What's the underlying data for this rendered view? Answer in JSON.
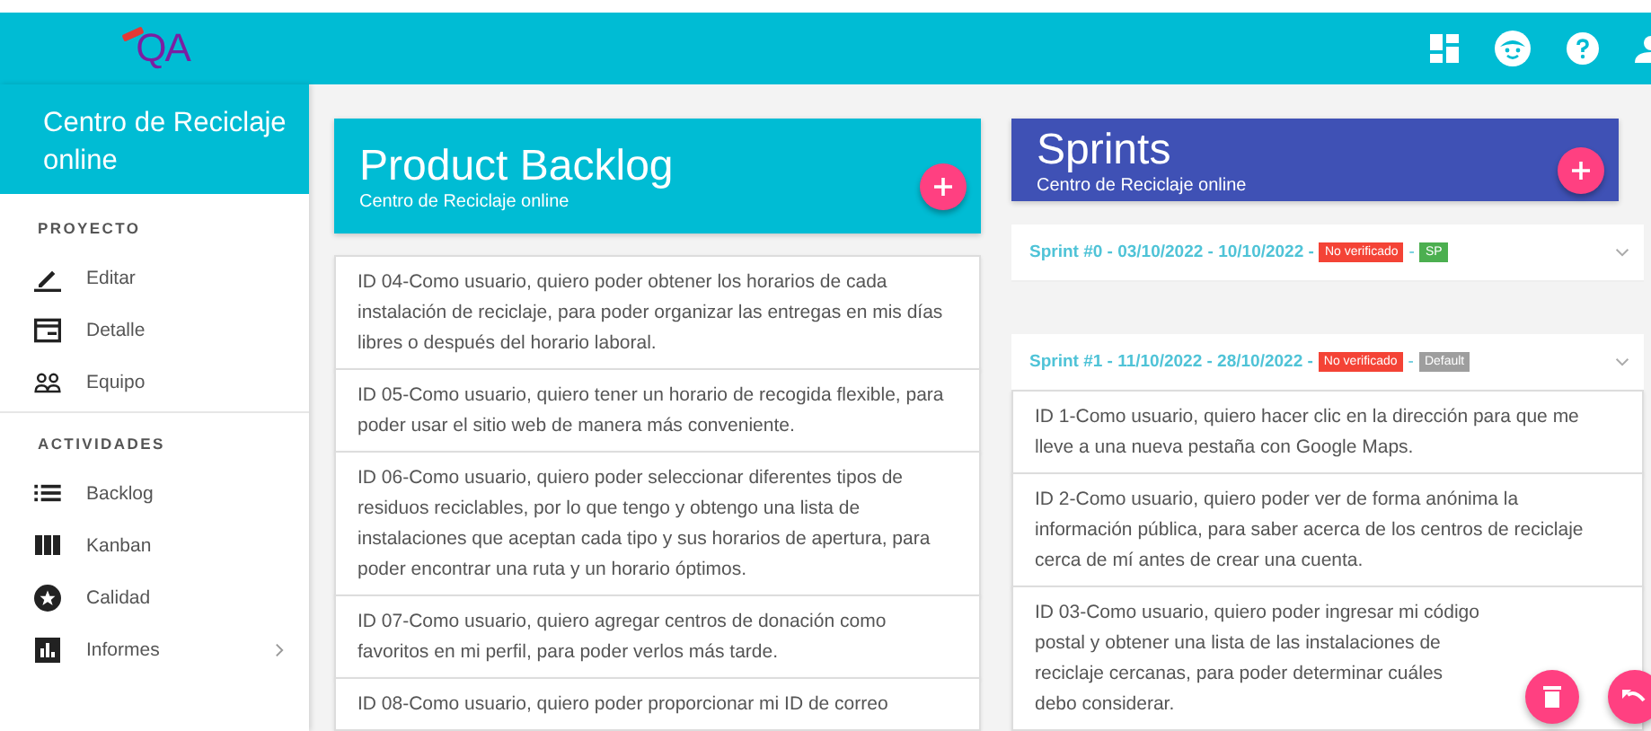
{
  "topbar": {
    "logo": "QA"
  },
  "sidebar": {
    "project_title": "Centro de Reciclaje online",
    "sections": [
      {
        "heading": "PROYECTO",
        "items": [
          {
            "label": "Editar",
            "has_submenu": false
          },
          {
            "label": "Detalle",
            "has_submenu": false
          },
          {
            "label": "Equipo",
            "has_submenu": false
          }
        ]
      },
      {
        "heading": "ACTIVIDADES",
        "items": [
          {
            "label": "Backlog",
            "has_submenu": false
          },
          {
            "label": "Kanban",
            "has_submenu": false
          },
          {
            "label": "Calidad",
            "has_submenu": false
          },
          {
            "label": "Informes",
            "has_submenu": true
          }
        ]
      }
    ]
  },
  "backlog": {
    "title": "Product Backlog",
    "subtitle": "Centro de Reciclaje online",
    "items": [
      "ID 04-Como usuario, quiero poder obtener los horarios de cada instalación de reciclaje, para poder organizar las entregas en mis días libres o después del horario laboral.",
      "ID 05-Como usuario, quiero tener un horario de recogida flexible, para poder usar el sitio web de manera más conveniente.",
      "ID 06-Como usuario, quiero poder seleccionar diferentes tipos de residuos reciclables, por lo que tengo y obtengo una lista de instalaciones que aceptan cada tipo y sus horarios de apertura, para poder encontrar una ruta y un horario óptimos.",
      "ID 07-Como usuario, quiero agregar centros de donación como favoritos en mi perfil, para poder verlos más tarde.",
      "ID 08-Como usuario, quiero poder proporcionar mi ID de correo"
    ]
  },
  "sprints": {
    "title": "Sprints",
    "subtitle": "Centro de Reciclaje online",
    "list": [
      {
        "title": "Sprint #0 - 03/10/2022 - 10/10/2022 -",
        "status": "No verificado",
        "separator": "-",
        "tag": "SP",
        "color": "#4caf50",
        "expanded": false
      },
      {
        "title": "Sprint #1 - 11/10/2022 - 28/10/2022 -",
        "status": "No verificado",
        "separator": "-",
        "tag": "Default",
        "color": "#9e9e9e",
        "expanded": true,
        "items": [
          "ID 1-Como usuario, quiero hacer clic en la dirección para que me lleve a una nueva pestaña con Google Maps.",
          "ID 2-Como usuario, quiero poder ver de forma anónima la información pública, para saber acerca de los centros de reciclaje cerca de mí antes de crear una cuenta.",
          "ID 03-Como usuario, quiero poder ingresar mi código postal y obtener una lista de las instalaciones de reciclaje cercanas, para poder determinar cuáles debo considerar."
        ]
      }
    ]
  }
}
